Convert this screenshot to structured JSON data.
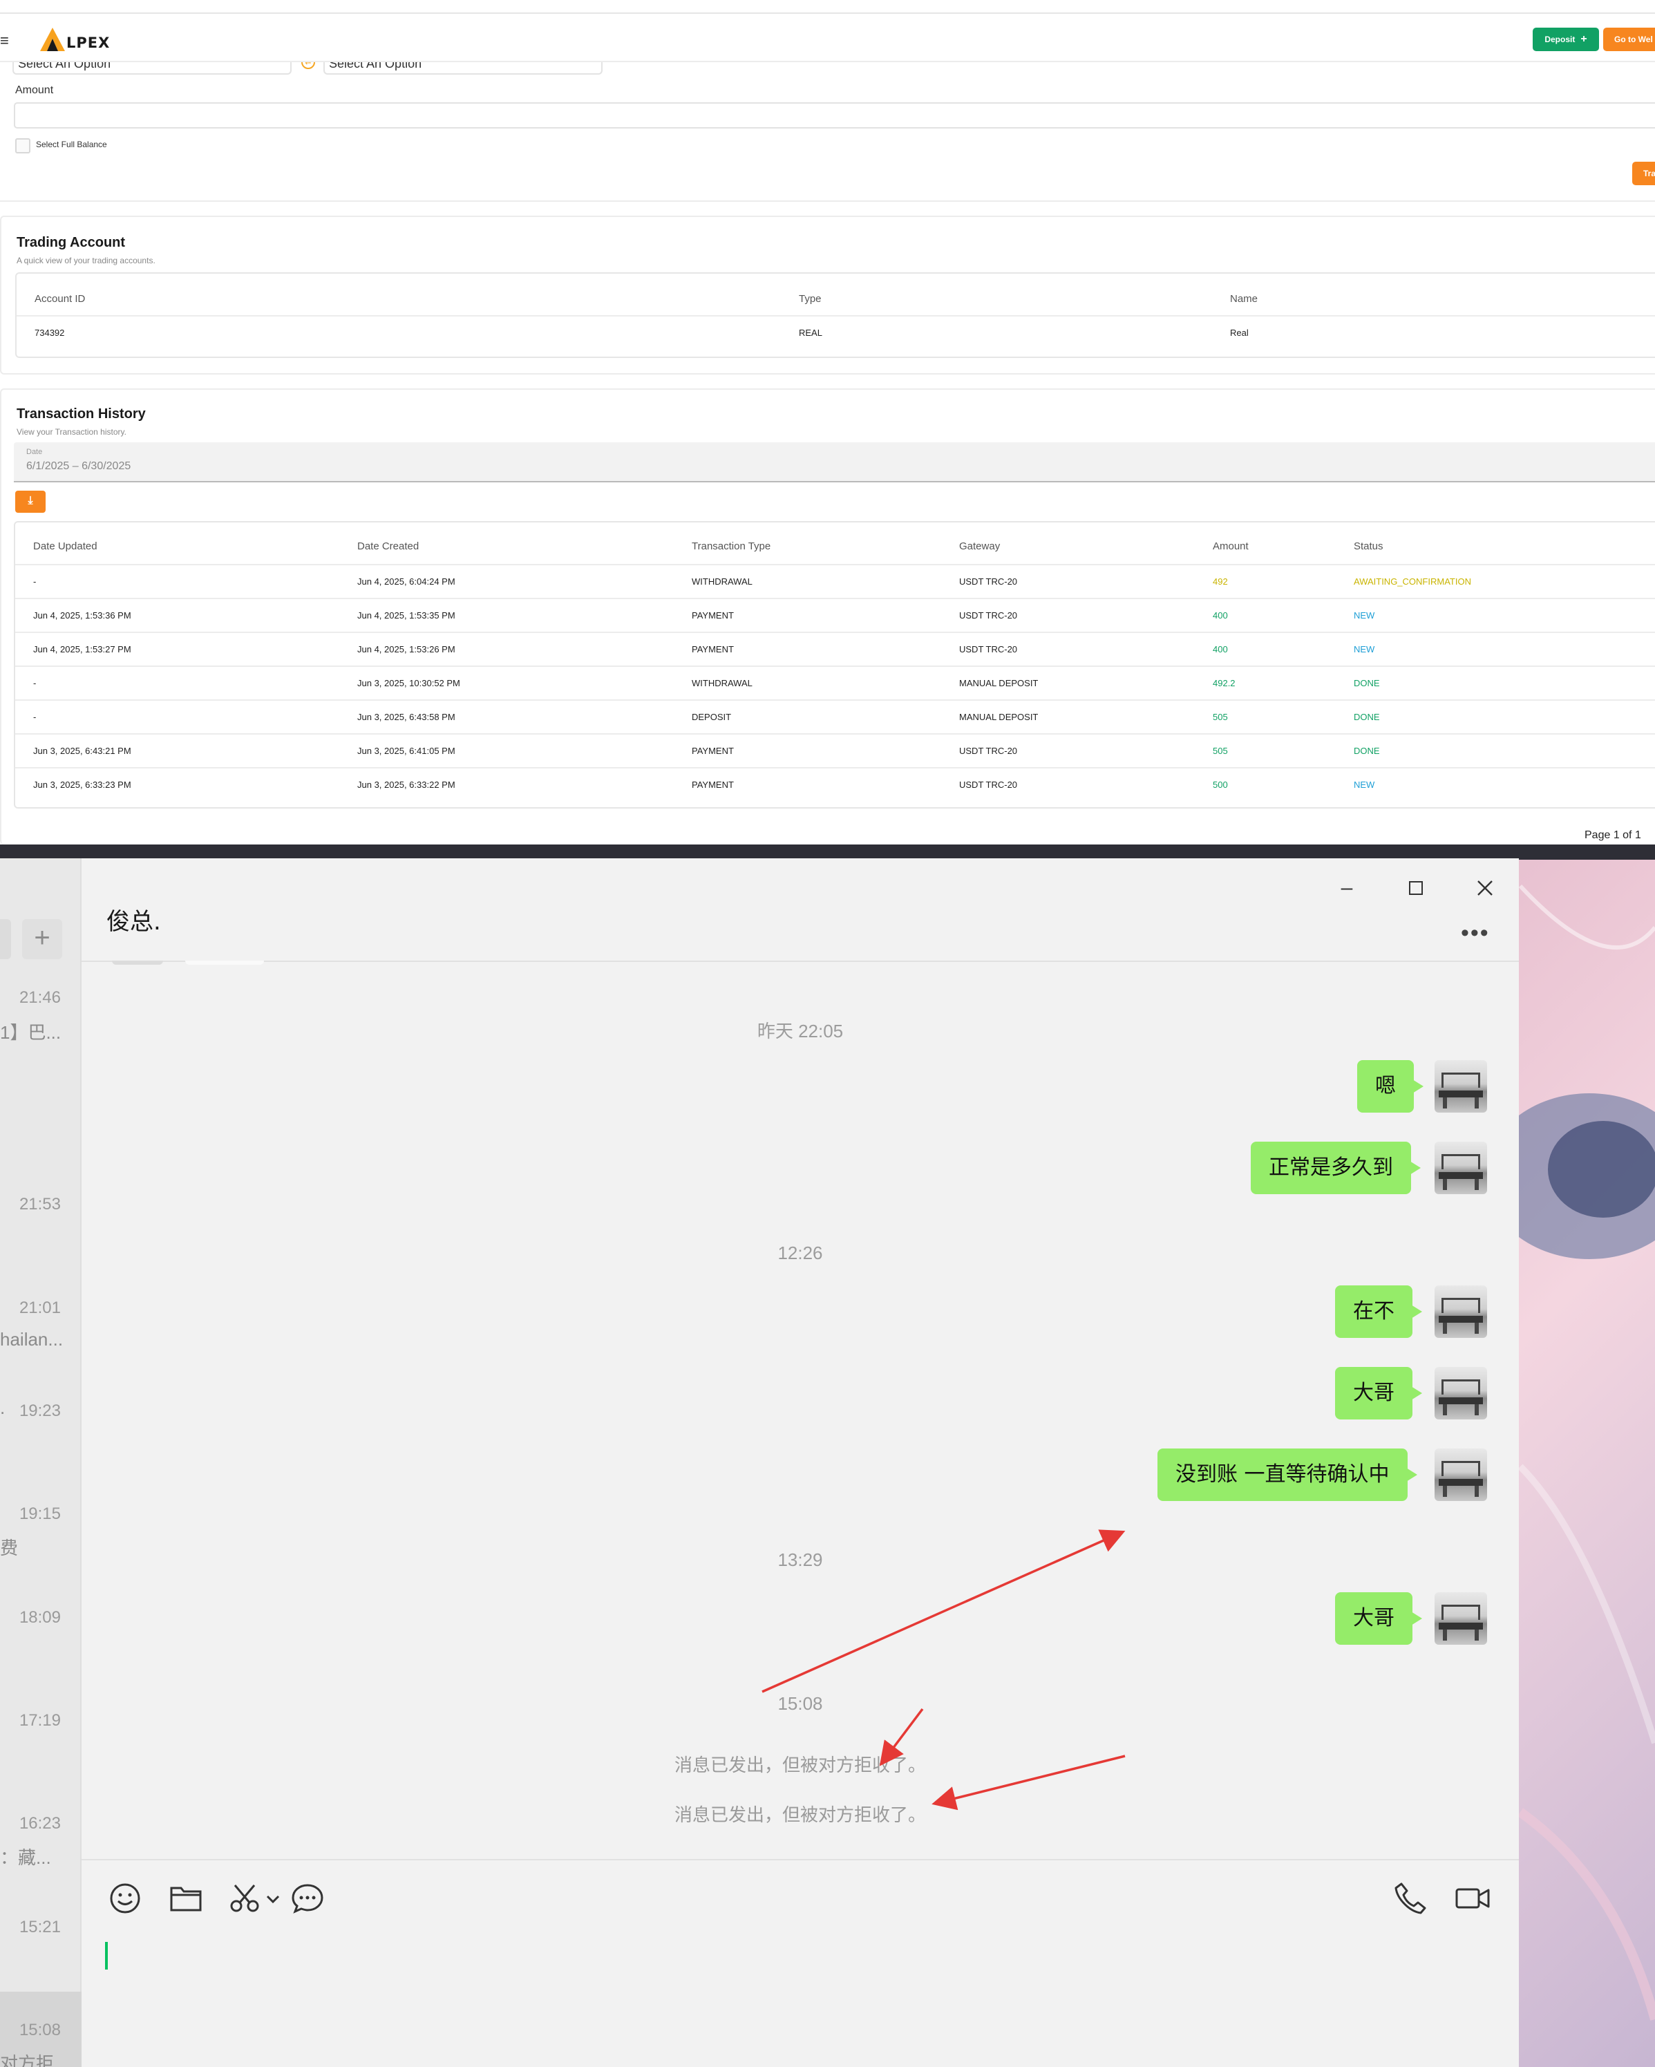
{
  "web": {
    "logo_text": "LPEX",
    "header": {
      "deposit_label": "Deposit",
      "goto_label": "Go to Wel"
    },
    "transfer": {
      "from_value": "Select An Option",
      "to_value": "Select An Option",
      "amount_label": "Amount",
      "amount_value": "",
      "select_full_balance_label": "Select Full Balance",
      "transfer_button_label": "Tra"
    },
    "trading_account": {
      "title": "Trading Account",
      "subtitle": "A quick view of your trading accounts.",
      "columns": [
        "Account ID",
        "Type",
        "Name"
      ],
      "rows": [
        [
          "734392",
          "REAL",
          "Real"
        ]
      ]
    },
    "transaction_history": {
      "title": "Transaction History",
      "subtitle": "View your Transaction history.",
      "date_label": "Date",
      "date_value": "6/1/2025 – 6/30/2025",
      "download_icon": "download-icon",
      "columns": [
        "Date Updated",
        "Date Created",
        "Transaction Type",
        "Gateway",
        "Amount",
        "Status"
      ],
      "rows": [
        [
          "-",
          "Jun 4, 2025, 6:04:24 PM",
          "WITHDRAWAL",
          "USDT TRC-20",
          "492",
          "AWAITING_CONFIRMATION"
        ],
        [
          "Jun 4, 2025, 1:53:36 PM",
          "Jun 4, 2025, 1:53:35 PM",
          "PAYMENT",
          "USDT TRC-20",
          "400",
          "NEW"
        ],
        [
          "Jun 4, 2025, 1:53:27 PM",
          "Jun 4, 2025, 1:53:26 PM",
          "PAYMENT",
          "USDT TRC-20",
          "400",
          "NEW"
        ],
        [
          "-",
          "Jun 3, 2025, 10:30:52 PM",
          "WITHDRAWAL",
          "MANUAL DEPOSIT",
          "492.2",
          "DONE"
        ],
        [
          "-",
          "Jun 3, 2025, 6:43:58 PM",
          "DEPOSIT",
          "MANUAL DEPOSIT",
          "505",
          "DONE"
        ],
        [
          "Jun 3, 2025, 6:43:21 PM",
          "Jun 3, 2025, 6:41:05 PM",
          "PAYMENT",
          "USDT TRC-20",
          "505",
          "DONE"
        ],
        [
          "Jun 3, 2025, 6:33:23 PM",
          "Jun 3, 2025, 6:33:22 PM",
          "PAYMENT",
          "USDT TRC-20",
          "500",
          "NEW"
        ]
      ],
      "page_info": "Page 1 of 1"
    },
    "colors": {
      "green": "#11a164",
      "orange": "#f7861f",
      "awaiting": "#c9b400",
      "status_blue": "#1e9fd6",
      "status_green": "#11a164"
    }
  },
  "chat": {
    "contact_name": "俊总.",
    "sidebar": {
      "times": [
        "21:46",
        "21:53",
        "21:01",
        "19:23",
        "19:15",
        "18:09",
        "17:19",
        "16:23",
        "15:21",
        "15:08"
      ],
      "snippets": [
        "1】巴...",
        "hailan...",
        ".",
        "费",
        "：藏...",
        "对方拒..."
      ]
    },
    "messages": [
      {
        "type": "time",
        "text": "昨天 22:05"
      },
      {
        "type": "out",
        "text": "嗯"
      },
      {
        "type": "out",
        "text": "正常是多久到"
      },
      {
        "type": "time",
        "text": "12:26"
      },
      {
        "type": "out",
        "text": "在不"
      },
      {
        "type": "out",
        "text": "大哥"
      },
      {
        "type": "out",
        "text": "没到账 一直等待确认中"
      },
      {
        "type": "time",
        "text": "13:29"
      },
      {
        "type": "out",
        "text": "大哥"
      },
      {
        "type": "time",
        "text": "15:08"
      },
      {
        "type": "system",
        "text": "消息已发出，但被对方拒收了。"
      },
      {
        "type": "system",
        "text": "消息已发出，但被对方拒收了。"
      }
    ],
    "toolbar_icons": [
      "emoji-icon",
      "folder-icon",
      "scissors-icon",
      "chevron-down-icon",
      "chat-bubble-icon",
      "phone-icon",
      "video-icon"
    ],
    "colors": {
      "bubble": "#95ec69",
      "caret": "#07c160",
      "arrow": "#e53935"
    }
  }
}
